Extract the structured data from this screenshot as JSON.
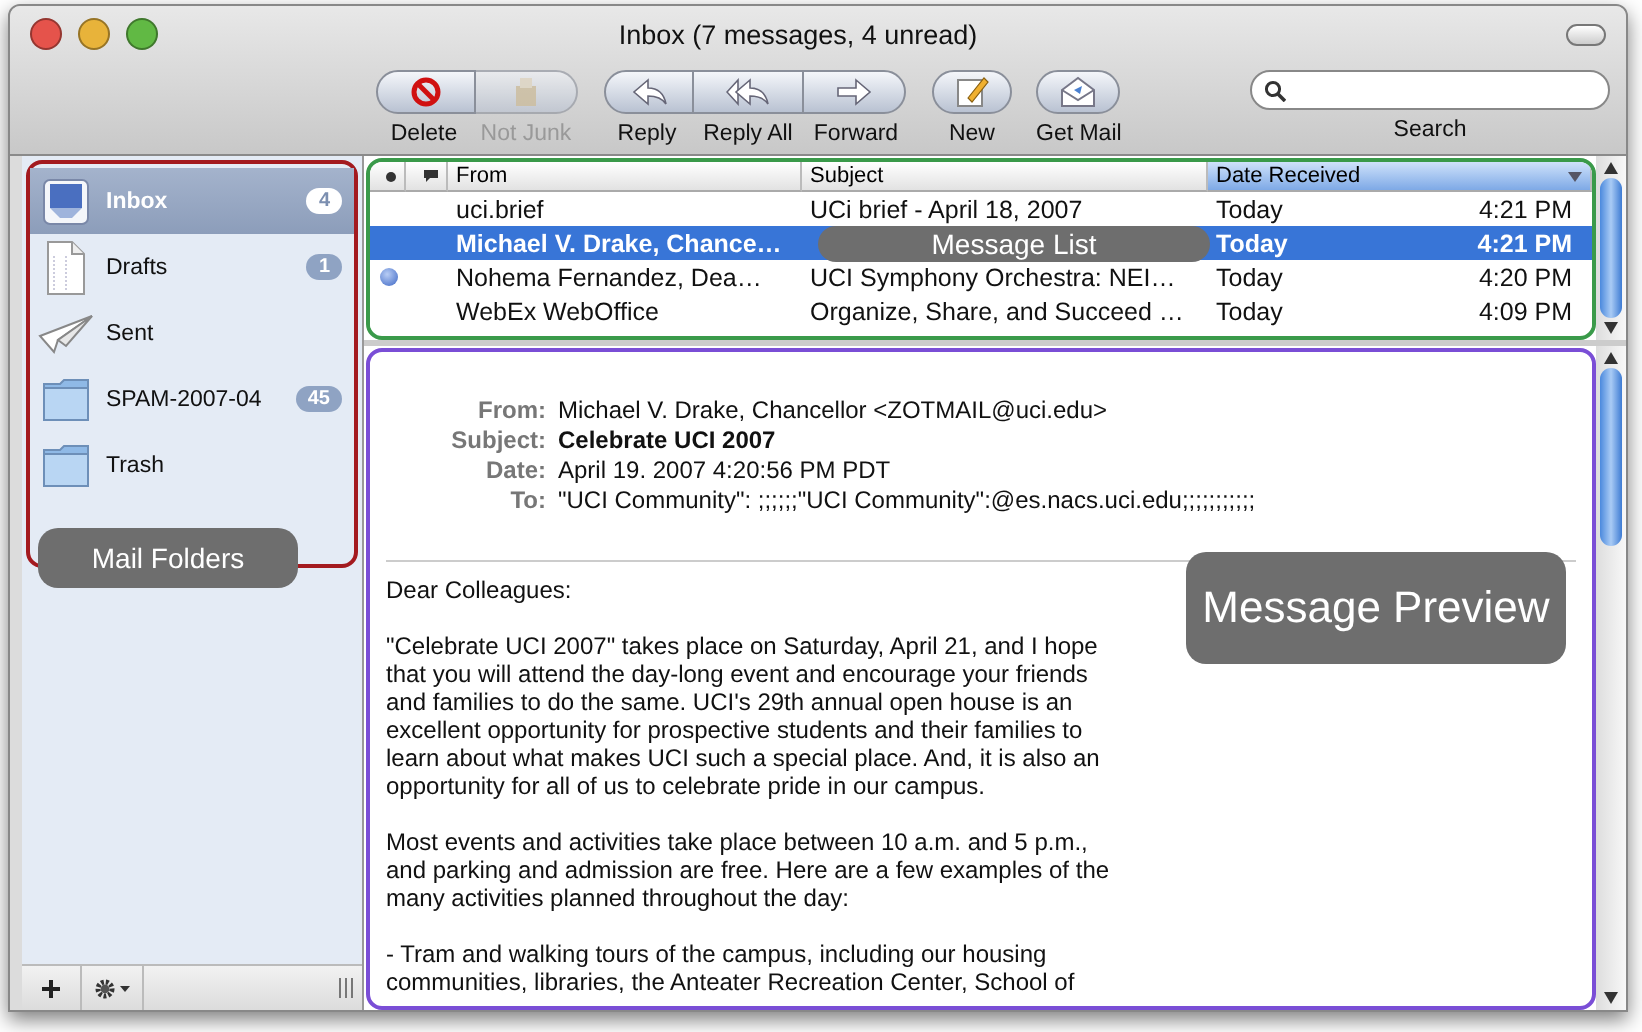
{
  "window": {
    "title": "Inbox (7 messages, 4 unread)"
  },
  "toolbar": {
    "groups": [
      {
        "buttons": [
          {
            "label": "Delete",
            "disabled": false
          },
          {
            "label": "Not Junk",
            "disabled": true
          }
        ]
      },
      {
        "buttons": [
          {
            "label": "Reply",
            "disabled": false
          },
          {
            "label": "Reply All",
            "disabled": false
          },
          {
            "label": "Forward",
            "disabled": false
          }
        ]
      },
      {
        "buttons": [
          {
            "label": "New",
            "disabled": false
          }
        ]
      },
      {
        "buttons": [
          {
            "label": "Get Mail",
            "disabled": false
          }
        ]
      }
    ],
    "search": {
      "label": "Search"
    }
  },
  "sidebar": {
    "items": [
      {
        "label": "Inbox",
        "count": "4",
        "selected": true
      },
      {
        "label": "Drafts",
        "count": "1",
        "selected": false
      },
      {
        "label": "Sent",
        "selected": false
      },
      {
        "label": "SPAM-2007-04",
        "count": "45",
        "selected": false
      },
      {
        "label": "Trash",
        "selected": false
      }
    ]
  },
  "message_list": {
    "columns": [
      {
        "kind": "status"
      },
      {
        "kind": "replied"
      },
      {
        "kind": "text",
        "label": "From"
      },
      {
        "kind": "text",
        "label": "Subject"
      },
      {
        "kind": "date",
        "label": "Date Received",
        "selected": true
      }
    ],
    "rows": [
      {
        "from": "uci.brief",
        "subject": "UCi brief - April 18, 2007",
        "date": "Today",
        "time": "4:21 PM",
        "unread": false,
        "selected": false
      },
      {
        "from": "Michael V. Drake, Chance…",
        "date": "Today",
        "time": "4:21 PM",
        "unread": false,
        "selected": true
      },
      {
        "from": "Nohema Fernandez, Dea…",
        "subject": "UCI Symphony Orchestra: NEI…",
        "date": "Today",
        "time": "4:20 PM",
        "unread": true,
        "selected": false
      },
      {
        "from": "WebEx WebOffice",
        "subject": "Organize, Share, and Succeed …",
        "date": "Today",
        "time": "4:09 PM",
        "unread": false,
        "selected": false
      }
    ]
  },
  "preview": {
    "headers": [
      {
        "label": "From:",
        "value": "Michael V. Drake, Chancellor <ZOTMAIL@uci.edu>",
        "bold": false
      },
      {
        "label": "Subject:",
        "value": "Celebrate UCI 2007",
        "bold": true
      },
      {
        "label": "Date:",
        "value": "April 19. 2007 4:20:56 PM PDT",
        "bold": false
      },
      {
        "label": "To:",
        "value": "\"UCI Community\": ;;;;;;\"UCI Community\":@es.nacs.uci.edu;;;;;;;;;;;",
        "bold": false
      }
    ],
    "body": [
      "Dear Colleagues:",
      "\"Celebrate UCI 2007\" takes place on Saturday, April 21, and I hope that you will attend the day-long event and encourage your friends and families to do the same. UCI's 29th annual open house is an excellent opportunity for prospective students and their families to learn about what makes UCI such a special place. And, it is also an opportunity for all of us to celebrate pride in our campus.",
      "Most events and activities take place between 10 a.m. and 5 p.m., and parking and admission are free. Here are a few examples of the many activities planned throughout the day:",
      "- Tram and walking tours of the campus, including our housing communities, libraries, the Anteater Recreation Center, School of"
    ]
  },
  "annotations": [
    {
      "label": "Mail Folders",
      "color": "#a31a1f"
    },
    {
      "label": "Message List",
      "color": "#3a9a4a"
    },
    {
      "label": "Message Preview",
      "color": "#7a4ed6"
    }
  ]
}
